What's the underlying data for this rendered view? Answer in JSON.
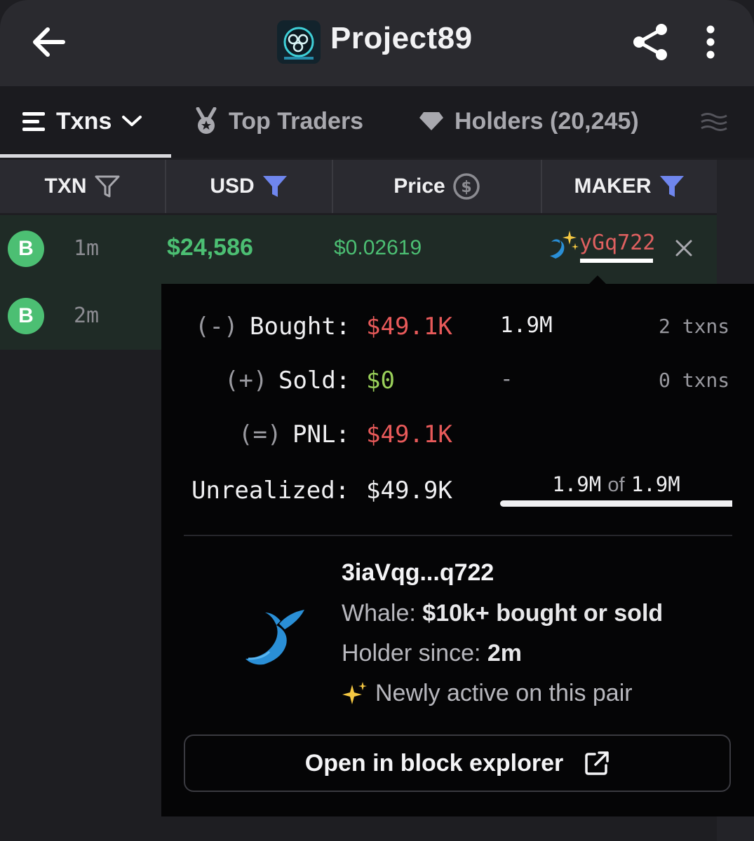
{
  "header": {
    "title": "Project89",
    "back_icon": "arrow-left-icon",
    "share_icon": "share-icon",
    "more_icon": "more-vertical-icon"
  },
  "tabs": [
    {
      "label": "Txns",
      "icon": "list-icon",
      "active": true
    },
    {
      "label": "Top Traders",
      "icon": "medal-icon",
      "active": false
    },
    {
      "label": "Holders (20,245)",
      "icon": "diamond-icon",
      "active": false
    }
  ],
  "columns": [
    {
      "label": "TXN",
      "filter": "outline"
    },
    {
      "label": "USD",
      "filter": "active"
    },
    {
      "label": "Price",
      "filter": "dollar-circle"
    },
    {
      "label": "MAKER",
      "filter": "active"
    }
  ],
  "rows": [
    {
      "type": "B",
      "age": "1m",
      "usd": "$24,586",
      "price": "$0.02619",
      "maker": "yGq722"
    },
    {
      "type": "B",
      "age": "2m"
    }
  ],
  "popup": {
    "bought_sign": "(-)",
    "bought_label": "Bought:",
    "bought_usd": "$49.1K",
    "bought_amount": "1.9M",
    "bought_txns": "2 txns",
    "sold_sign": "(+)",
    "sold_label": "Sold:",
    "sold_usd": "$0",
    "sold_amount": "-",
    "sold_txns": "0 txns",
    "pnl_sign": "(=)",
    "pnl_label": "PNL:",
    "pnl_usd": "$49.1K",
    "unrealized_label": "Unrealized:",
    "unrealized_usd": "$49.9K",
    "holding_current": "1.9M",
    "holding_of": "of",
    "holding_total": "1.9M",
    "holding_fraction": 1.0,
    "address": "3iaVqg...q722",
    "whale_label": "Whale:",
    "whale_value": "$10k+ bought or sold",
    "holder_label": "Holder since:",
    "holder_value": "2m",
    "newly_active": "Newly active on this pair",
    "explorer_button": "Open in block explorer"
  },
  "colors": {
    "buy_green": "#4cbf73",
    "loss_red": "#e85a5a",
    "gain_green": "#9ad05a",
    "filter_blue": "#6f86ee"
  }
}
